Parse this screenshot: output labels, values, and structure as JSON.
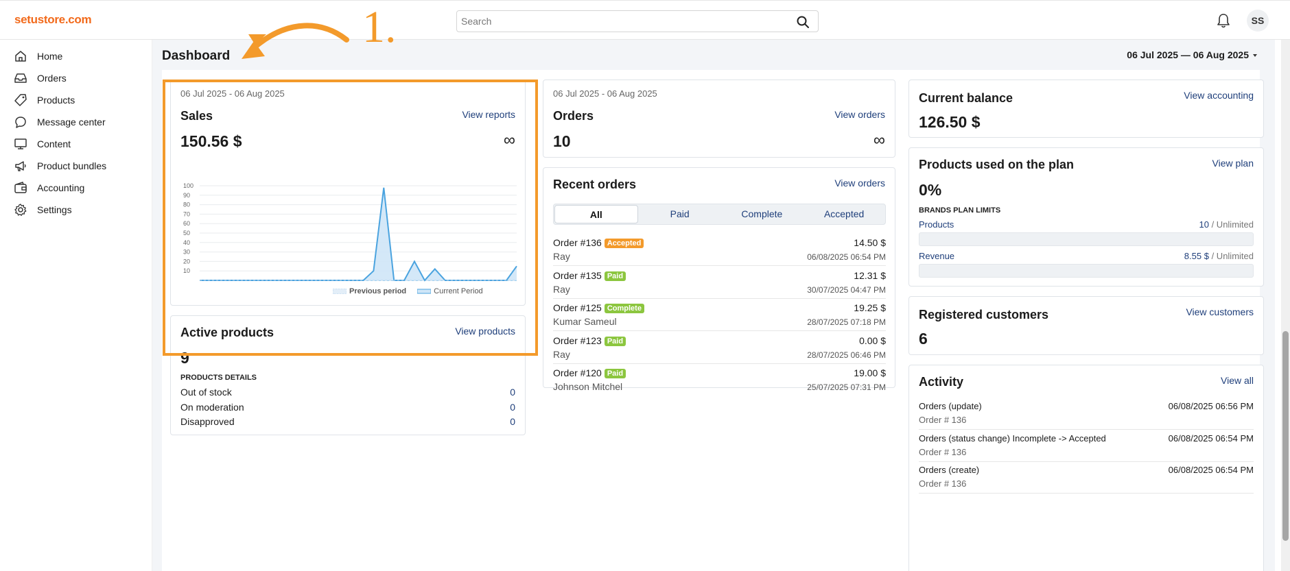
{
  "app": {
    "logo": "setustore.com"
  },
  "header": {
    "search_placeholder": "Search",
    "avatar_initials": "SS"
  },
  "sidebar": {
    "items": [
      {
        "label": "Home",
        "icon": "home-icon"
      },
      {
        "label": "Orders",
        "icon": "inbox-icon"
      },
      {
        "label": "Products",
        "icon": "tag-icon"
      },
      {
        "label": "Message center",
        "icon": "chat-icon"
      },
      {
        "label": "Content",
        "icon": "monitor-icon"
      },
      {
        "label": "Product bundles",
        "icon": "megaphone-icon"
      },
      {
        "label": "Accounting",
        "icon": "wallet-icon"
      },
      {
        "label": "Settings",
        "icon": "gear-icon"
      }
    ]
  },
  "page": {
    "title": "Dashboard",
    "date_range": "06 Jul 2025 — 06 Aug 2025"
  },
  "annotation": {
    "number": "1."
  },
  "sales": {
    "date": "06 Jul 2025 - 06 Aug 2025",
    "title": "Sales",
    "link": "View reports",
    "value": "150.56 $",
    "infinity": "∞",
    "legend_previous": "Previous period",
    "legend_current": "Current Period"
  },
  "chart_data": {
    "type": "area",
    "y_ticks": [
      10,
      20,
      30,
      40,
      50,
      60,
      70,
      80,
      90,
      100
    ],
    "ylim": [
      0,
      100
    ],
    "series": [
      {
        "name": "Current Period",
        "values": [
          0,
          0,
          0,
          0,
          0,
          0,
          0,
          0,
          0,
          0,
          0,
          0,
          0,
          0,
          0,
          0,
          0,
          10,
          98,
          0,
          0,
          20,
          0,
          12,
          0,
          0,
          0,
          0,
          0,
          0,
          0,
          15
        ]
      },
      {
        "name": "Previous period",
        "values": [
          0,
          0,
          0,
          0,
          0,
          0,
          0,
          0,
          0,
          0,
          0,
          0,
          0,
          0,
          0,
          0,
          0,
          0,
          0,
          0,
          0,
          0,
          0,
          0,
          0,
          0,
          0,
          0,
          0,
          0,
          0,
          0
        ]
      }
    ]
  },
  "orders_card": {
    "date": "06 Jul 2025 - 06 Aug 2025",
    "title": "Orders",
    "link": "View orders",
    "value": "10",
    "infinity": "∞"
  },
  "active_products": {
    "title": "Active products",
    "link": "View products",
    "value": "9",
    "details_label": "PRODUCTS DETAILS",
    "rows": [
      {
        "label": "Out of stock",
        "value": "0"
      },
      {
        "label": "On moderation",
        "value": "0"
      },
      {
        "label": "Disapproved",
        "value": "0"
      }
    ]
  },
  "recent_orders": {
    "title": "Recent orders",
    "link": "View orders",
    "tabs": [
      "All",
      "Paid",
      "Complete",
      "Accepted"
    ],
    "rows": [
      {
        "id": "Order #136",
        "status": "Accepted",
        "status_color": "#f39a2b",
        "amount": "14.50 $",
        "customer": "Ray",
        "date": "06/08/2025 06:54 PM"
      },
      {
        "id": "Order #135",
        "status": "Paid",
        "status_color": "#8cc63f",
        "amount": "12.31 $",
        "customer": "Ray",
        "date": "30/07/2025 04:47 PM"
      },
      {
        "id": "Order #125",
        "status": "Complete",
        "status_color": "#8cc63f",
        "amount": "19.25 $",
        "customer": "Kumar Sameul",
        "date": "28/07/2025 07:18 PM"
      },
      {
        "id": "Order #123",
        "status": "Paid",
        "status_color": "#8cc63f",
        "amount": "0.00 $",
        "customer": "Ray",
        "date": "28/07/2025 06:46 PM"
      },
      {
        "id": "Order #120",
        "status": "Paid",
        "status_color": "#8cc63f",
        "amount": "19.00 $",
        "customer": "Johnson Mitchel",
        "date": "25/07/2025 07:31 PM"
      }
    ]
  },
  "balance": {
    "title": "Current balance",
    "link": "View accounting",
    "value": "126.50 $"
  },
  "plan": {
    "title": "Products used on the plan",
    "link": "View plan",
    "value": "0%",
    "limits_label": "BRANDS PLAN LIMITS",
    "products_label": "Products",
    "products_value": "10",
    "products_limit": "/ Unlimited",
    "revenue_label": "Revenue",
    "revenue_value": "8.55 $",
    "revenue_limit": "/ Unlimited",
    "products_fill": 0,
    "revenue_fill": 0
  },
  "customers": {
    "title": "Registered customers",
    "link": "View customers",
    "value": "6"
  },
  "activity": {
    "title": "Activity",
    "link": "View all",
    "rows": [
      {
        "title": "Orders (update)",
        "sub": "Order # 136",
        "time": "06/08/2025 06:56 PM"
      },
      {
        "title": "Orders (status change) Incomplete -> Accepted",
        "sub": "Order # 136",
        "time": "06/08/2025 06:54 PM"
      },
      {
        "title": "Orders (create)",
        "sub": "Order # 136",
        "time": "06/08/2025 06:54 PM"
      }
    ]
  },
  "colors": {
    "accent": "#f26a1b",
    "annotation": "#f39a2b",
    "link": "#1e3e7a",
    "chart_line": "#4aa3df",
    "chart_fill": "#cfe6f7"
  }
}
